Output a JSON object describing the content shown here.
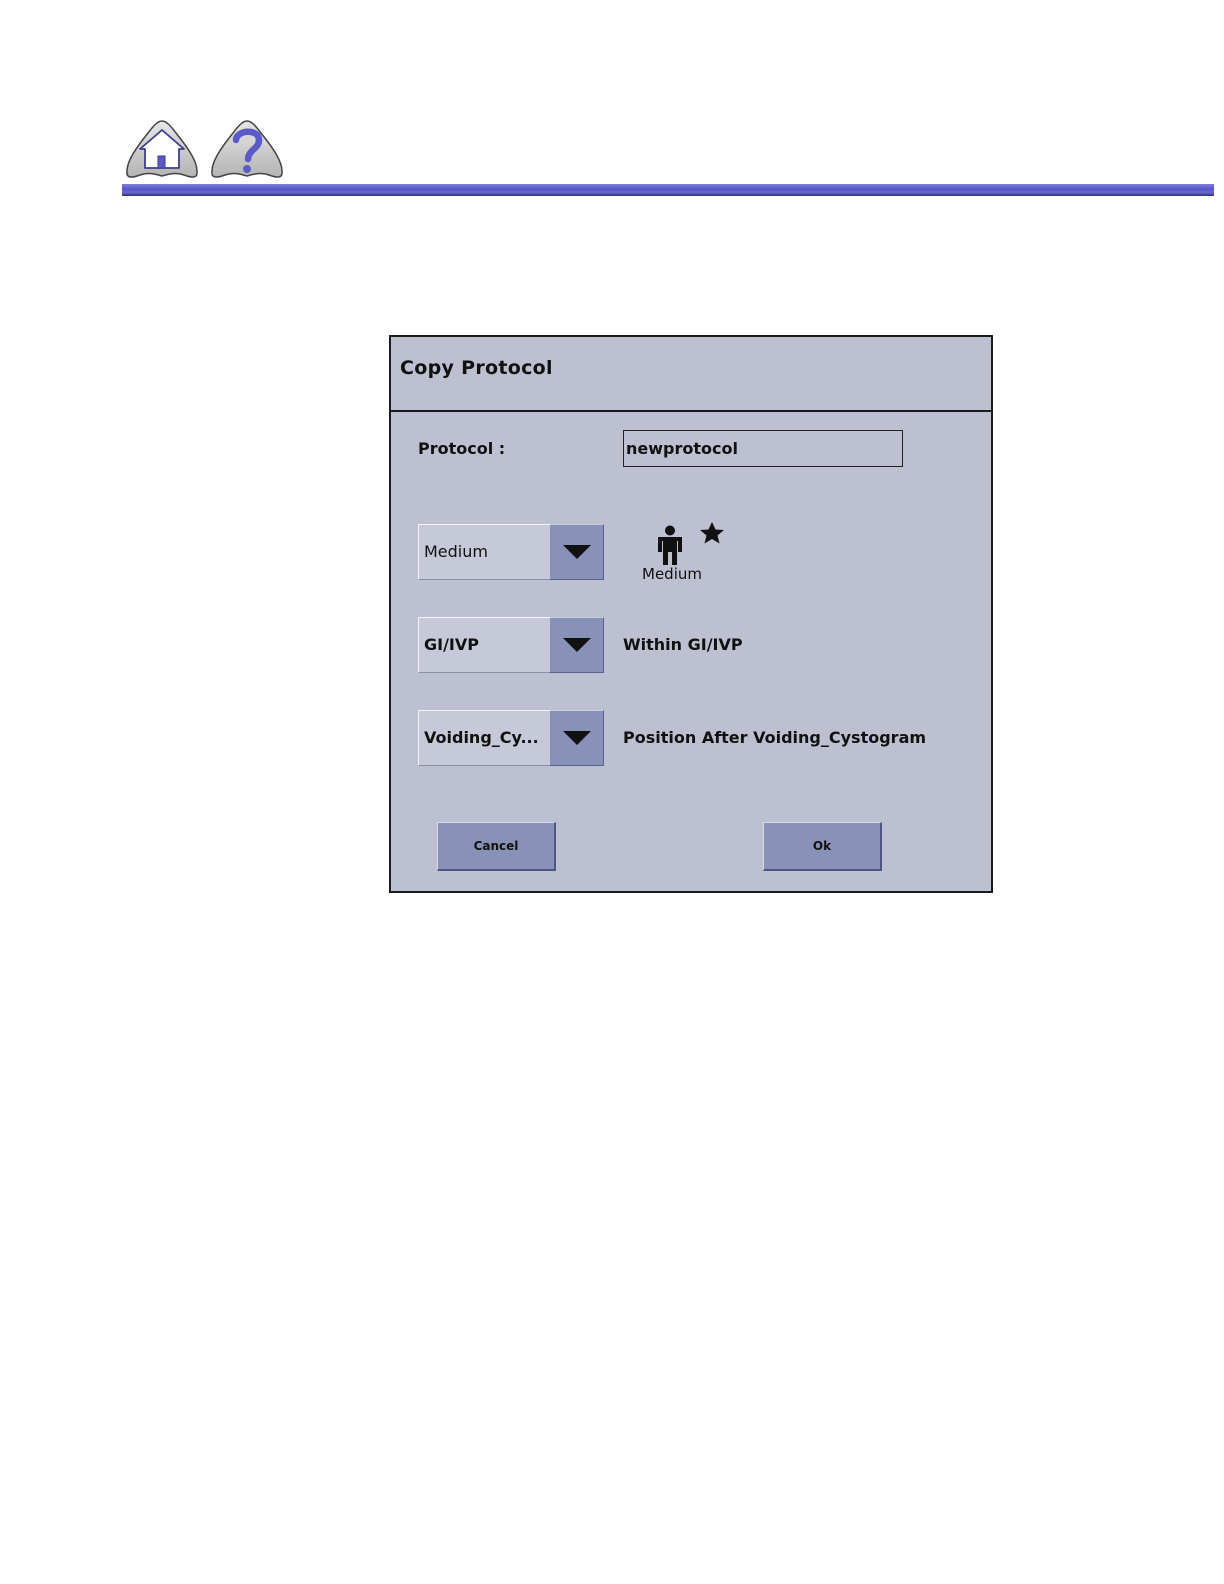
{
  "nav": {
    "home_icon": "home-icon",
    "help_icon": "question-mark-icon"
  },
  "dialog": {
    "title": "Copy Protocol",
    "protocol_label": "Protocol :",
    "protocol_value": "newprotocol",
    "patient_size": {
      "selected": "Medium",
      "icon": "patient-figure-icon",
      "marker_icon": "star-icon",
      "caption": "Medium"
    },
    "category": {
      "selected": "GI/IVP",
      "description": "Within GI/IVP"
    },
    "position": {
      "selected": "Voiding_Cy...",
      "description": "Position After Voiding_Cystogram"
    },
    "cancel_label": "Cancel",
    "ok_label": "Ok"
  },
  "colors": {
    "dialog_bg": "#bcc0d0",
    "button_bg": "#8892b9",
    "header_rule": "#5555c8"
  }
}
